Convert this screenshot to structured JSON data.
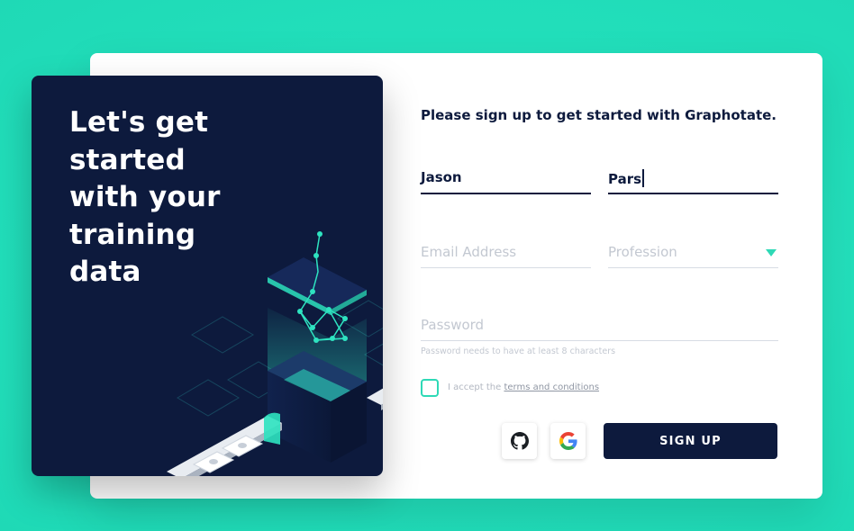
{
  "hero": {
    "title_lines": [
      "Let's get",
      "started",
      "with your",
      "training",
      "data"
    ]
  },
  "form": {
    "title": "Please sign up to get started with Graphotate.",
    "first_name": {
      "value": "Jason"
    },
    "last_name": {
      "value": "Pars"
    },
    "email": {
      "placeholder": "Email Address"
    },
    "profession": {
      "placeholder": "Profession",
      "icon": "caret-down-icon"
    },
    "password": {
      "placeholder": "Password",
      "hint": "Password needs to have at least 8 characters"
    },
    "terms": {
      "prefix": "I accept the ",
      "link": "terms and conditions"
    },
    "social": [
      {
        "name": "github",
        "icon": "github-icon"
      },
      {
        "name": "google",
        "icon": "google-icon"
      }
    ],
    "submit_label": "SIGN UP"
  },
  "colors": {
    "background": "#2ee3c0",
    "navy": "#0d1a3d",
    "accent": "#2ed9b6"
  }
}
